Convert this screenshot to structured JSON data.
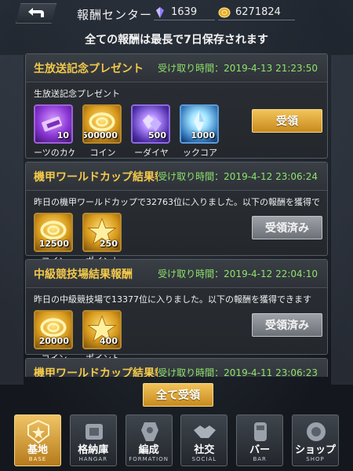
{
  "header": {
    "title": "報酬センター",
    "diamonds": "1639",
    "coins": "6271824"
  },
  "notice": "全ての報酬は最長で7日保存されます",
  "rewards": [
    {
      "title": "生放送記念プレゼント",
      "time": "受け取り時間：2019-4-13 21:23:50",
      "desc": "生放送記念プレゼント",
      "button": "受領",
      "items": [
        {
          "name": "ーツのカケ",
          "qty": "10",
          "icon": "parts-fragment-icon"
        },
        {
          "name": "コイン",
          "qty": "500000",
          "icon": "coin-icon"
        },
        {
          "name": "ーダイヤ",
          "qty": "500",
          "icon": "diamond-icon"
        },
        {
          "name": "ックコア",
          "qty": "1000",
          "icon": "core-crystal-icon"
        }
      ]
    },
    {
      "title": "機甲ワールドカップ結果報酬",
      "time": "受け取り時間：2019-4-12 23:06:24",
      "desc": "昨日の機甲ワールドカップで32763位に入りました。以下の報酬を獲得できます",
      "button": "受領済み",
      "items": [
        {
          "name": "コイン",
          "qty": "12500",
          "icon": "coin-icon"
        },
        {
          "name": "ポイント",
          "qty": "250",
          "icon": "star-point-icon"
        }
      ]
    },
    {
      "title": "中級競技場結果報酬",
      "time": "受け取り時間：2019-4-12 22:04:10",
      "desc": "昨日の中級競技場で13377位に入りました。以下の報酬を獲得できます",
      "button": "受領済み",
      "items": [
        {
          "name": "コイン",
          "qty": "20000",
          "icon": "coin-icon"
        },
        {
          "name": "ポイント",
          "qty": "400",
          "icon": "star-point-icon"
        }
      ]
    },
    {
      "title": "機甲ワールドカップ結果報酬",
      "time": "受け取り時間：2019-4-11 23:06:23"
    }
  ],
  "claim_all": "全て受領",
  "nav": [
    {
      "label": "基地",
      "sub": "BASE",
      "icon": "base-emblem-icon",
      "active": true
    },
    {
      "label": "格納庫",
      "sub": "HANGAR",
      "icon": "hangar-icon"
    },
    {
      "label": "編成",
      "sub": "FORMATION",
      "icon": "formation-icon"
    },
    {
      "label": "社交",
      "sub": "SOCIAL",
      "icon": "handshake-icon"
    },
    {
      "label": "バー",
      "sub": "BAR",
      "icon": "bar-icon"
    },
    {
      "label": "ショップ",
      "sub": "SHOP",
      "icon": "shop-icon"
    }
  ],
  "colors": {
    "accent_gold": "#f3c94a",
    "time_green": "#8ee36a",
    "claim_button": "#e0a83c",
    "claimed_button": "#8a8e94"
  }
}
